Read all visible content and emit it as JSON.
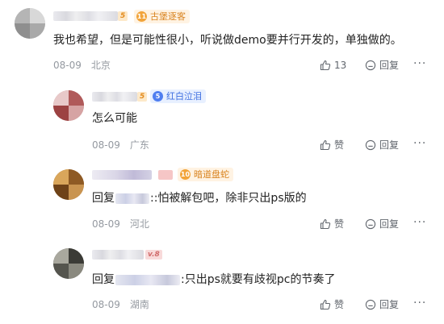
{
  "comments": [
    {
      "level": "5",
      "badge": {
        "num": "11",
        "label": "古堡逐客",
        "color": "orange"
      },
      "text": "我也希望，但是可能性很小，听说做demo要并行开发的，单独做的。",
      "date": "08-09",
      "location": "北京",
      "like_label": "13",
      "reply_label": "回复",
      "more_label": "···"
    },
    {
      "level": "5",
      "badge": {
        "num": "5",
        "label": "红白泣泪",
        "color": "blue"
      },
      "text": "怎么可能",
      "date": "08-09",
      "location": "广东",
      "like_label": "赞",
      "reply_label": "回复",
      "more_label": "···"
    },
    {
      "level": "",
      "badge": {
        "num": "10",
        "label": "暗道盘蛇",
        "color": "orange"
      },
      "reply_prefix": "回复",
      "text": "::怕被解包吧，除非只出ps版的",
      "date": "08-09",
      "location": "河北",
      "like_label": "赞",
      "reply_label": "回复",
      "more_label": "···"
    },
    {
      "level": "v.8",
      "badge": null,
      "reply_prefix": "回复",
      "text": ":只出ps就要有歧视pc的节奏了",
      "date": "08-09",
      "location": "湖南",
      "like_label": "赞",
      "reply_label": "回复",
      "more_label": "···"
    }
  ],
  "colors": {
    "meta_gray": "#9499a0",
    "action_gray": "#61666d",
    "badge_orange": "#f2a43a",
    "badge_blue": "#4f7ef0"
  },
  "icons": [
    "thumb-up-icon",
    "reply-bubble-icon",
    "more-dots-icon",
    "rank-badge-icon"
  ]
}
